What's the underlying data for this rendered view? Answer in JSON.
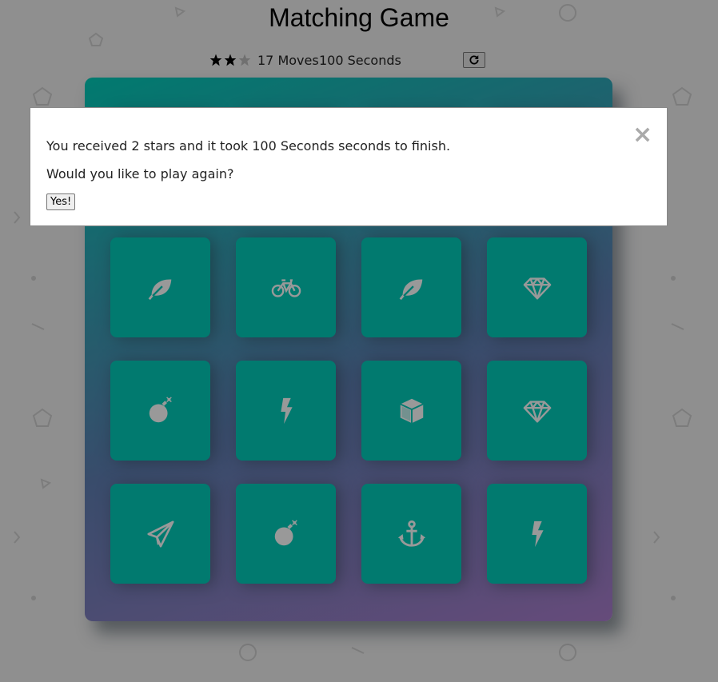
{
  "title": "Matching Game",
  "score_panel": {
    "stars_earned": 2,
    "stars_total": 3,
    "moves": "17 Moves",
    "timer": "100 Seconds"
  },
  "colors": {
    "card": "#02ccba",
    "icon": "#ffffff",
    "star_filled": "#000000",
    "star_empty": "#bbbbbb"
  },
  "deck": {
    "cards": [
      {
        "icon": "leaf-icon"
      },
      {
        "icon": "bicycle-icon"
      },
      {
        "icon": "leaf-icon"
      },
      {
        "icon": "diamond-icon"
      },
      {
        "icon": "bomb-icon"
      },
      {
        "icon": "bolt-icon"
      },
      {
        "icon": "cube-icon"
      },
      {
        "icon": "diamond-icon"
      },
      {
        "icon": "paper-plane-icon"
      },
      {
        "icon": "bomb-icon"
      },
      {
        "icon": "anchor-icon"
      },
      {
        "icon": "bolt-icon"
      }
    ]
  },
  "modal": {
    "close_symbol": "×",
    "message": "You received 2 stars and it took 100 Seconds seconds to finish.",
    "question": "Would you like to play again?",
    "yes_label": "Yes!"
  }
}
